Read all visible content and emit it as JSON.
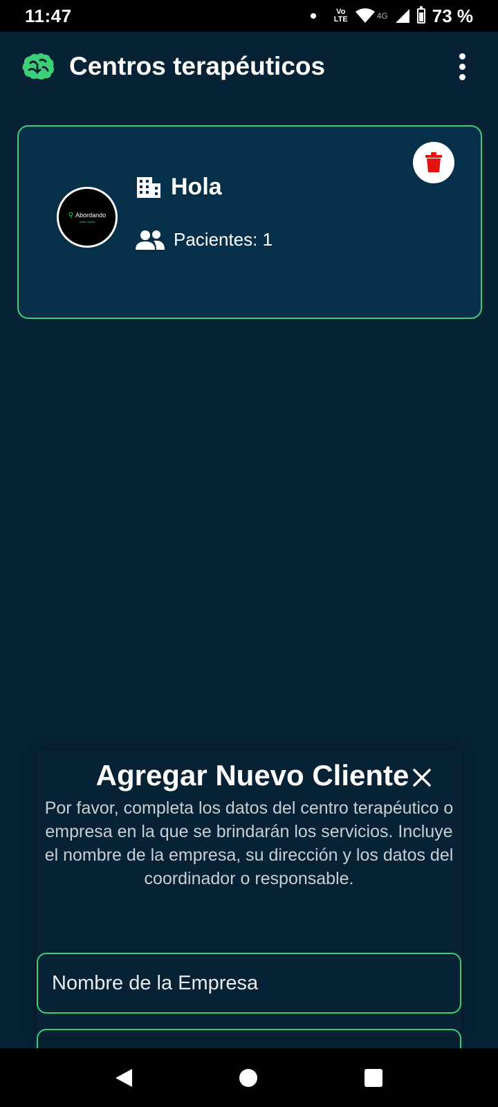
{
  "status_bar": {
    "time": "11:47",
    "volte_top": "Vo",
    "volte_bottom": "LTE",
    "network": "4G",
    "battery": "73 %"
  },
  "app_bar": {
    "title": "Centros terapéuticos",
    "logo_icon": "brain-icon",
    "menu_icon": "more-vert-icon"
  },
  "card": {
    "name": "Hola",
    "patients_label": "Pacientes: 1",
    "logo_text": "Abordando",
    "logo_subtext": "salud mental",
    "building_icon": "building-icon",
    "users_icon": "users-icon",
    "delete_icon": "trash-icon"
  },
  "sheet": {
    "title": "Agregar Nuevo Cliente",
    "description": "Por favor, completa los datos del centro terapéutico o empresa en la que se brindarán los servicios. Incluye el nombre de la empresa, su dirección y los datos del coordinador o responsable.",
    "company_name_placeholder": "Nombre de la Empresa",
    "second_field_placeholder": ""
  },
  "colors": {
    "background": "#062234",
    "card_bg": "#063049",
    "accent_green": "#3ccf78",
    "delete_red": "#e3130f"
  }
}
